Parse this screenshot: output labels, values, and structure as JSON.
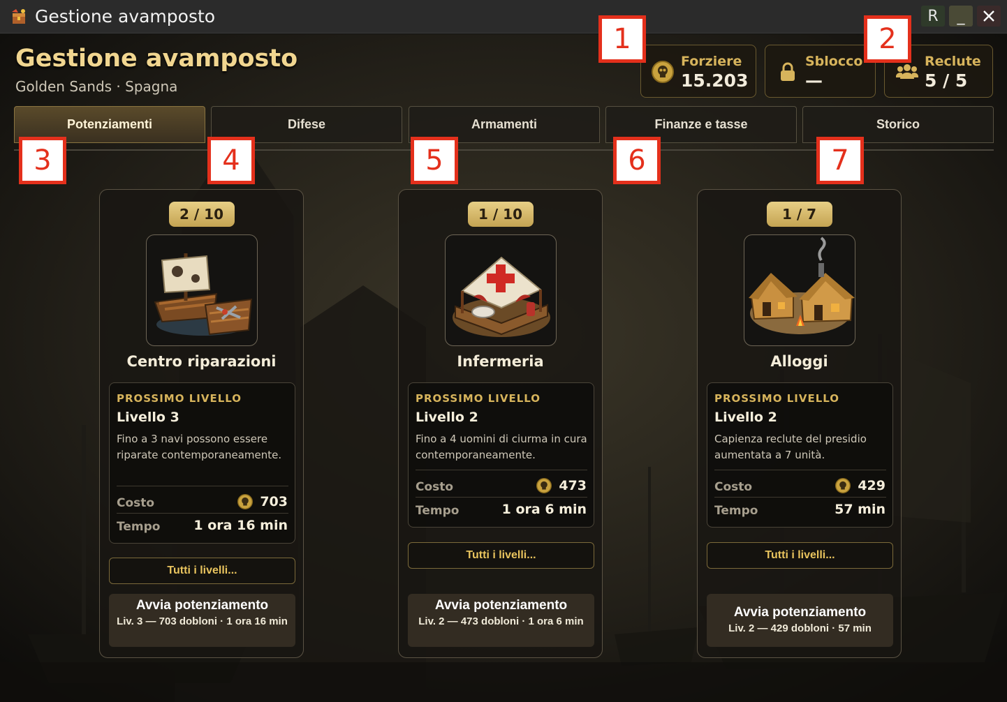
{
  "window": {
    "title": "Gestione avamposto",
    "buttons": {
      "r": "R",
      "minimize": "_"
    }
  },
  "header": {
    "title": "Gestione avamposto",
    "subtitle": "Golden Sands · Spagna"
  },
  "stats": {
    "chest": {
      "label": "Forziere",
      "value": "15.203",
      "icon": "skull-coin-icon"
    },
    "unlock": {
      "label": "Sblocco",
      "value": "—",
      "icon": "lock-icon"
    },
    "recruits": {
      "label": "Reclute",
      "value": "5 / 5",
      "icon": "users-icon"
    }
  },
  "tabs": [
    {
      "label": "Potenziamenti",
      "active": true
    },
    {
      "label": "Difese",
      "active": false
    },
    {
      "label": "Armamenti",
      "active": false
    },
    {
      "label": "Finanze e tasse",
      "active": false
    },
    {
      "label": "Storico",
      "active": false
    }
  ],
  "markers": [
    "1",
    "2",
    "3",
    "4",
    "5",
    "6",
    "7"
  ],
  "labels": {
    "next": "PROSSIMO LIVELLO",
    "cost": "Costo",
    "time": "Tempo",
    "all_levels": "Tutti i livelli...",
    "start": "Avvia potenziamento"
  },
  "buildings": [
    {
      "name": "Centro riparazioni",
      "level": "2 / 10",
      "level_current": 2,
      "level_max": 10,
      "icon": "ship-repair-icon",
      "next_level": "Livello 3",
      "description": "Fino a 3 navi possono essere riparate contemporaneamente.",
      "cost": "703",
      "time": "1 ora 16 min",
      "start_detail": "Liv. 3 — 703 dobloni · 1 ora 16 min"
    },
    {
      "name": "Infermeria",
      "level": "1 / 10",
      "level_current": 1,
      "level_max": 10,
      "icon": "infirmary-tent-icon",
      "next_level": "Livello 2",
      "description": "Fino a 4 uomini di ciurma in cura contemporaneamente.",
      "cost": "473",
      "time": "1 ora 6 min",
      "start_detail": "Liv. 2 — 473 dobloni · 1 ora 6 min"
    },
    {
      "name": "Alloggi",
      "level": "1 / 7",
      "level_current": 1,
      "level_max": 7,
      "icon": "lodging-huts-icon",
      "next_level": "Livello 2",
      "description": "Capienza reclute del presidio aumentata a 7 unità.",
      "cost": "429",
      "time": "57 min",
      "start_detail": "Liv. 2 — 429 dobloni · 57 min"
    }
  ],
  "colors": {
    "gold": "#d7b45c",
    "title_gold": "#f1d690",
    "marker_red": "#e4301c",
    "panel": "#18160f"
  }
}
